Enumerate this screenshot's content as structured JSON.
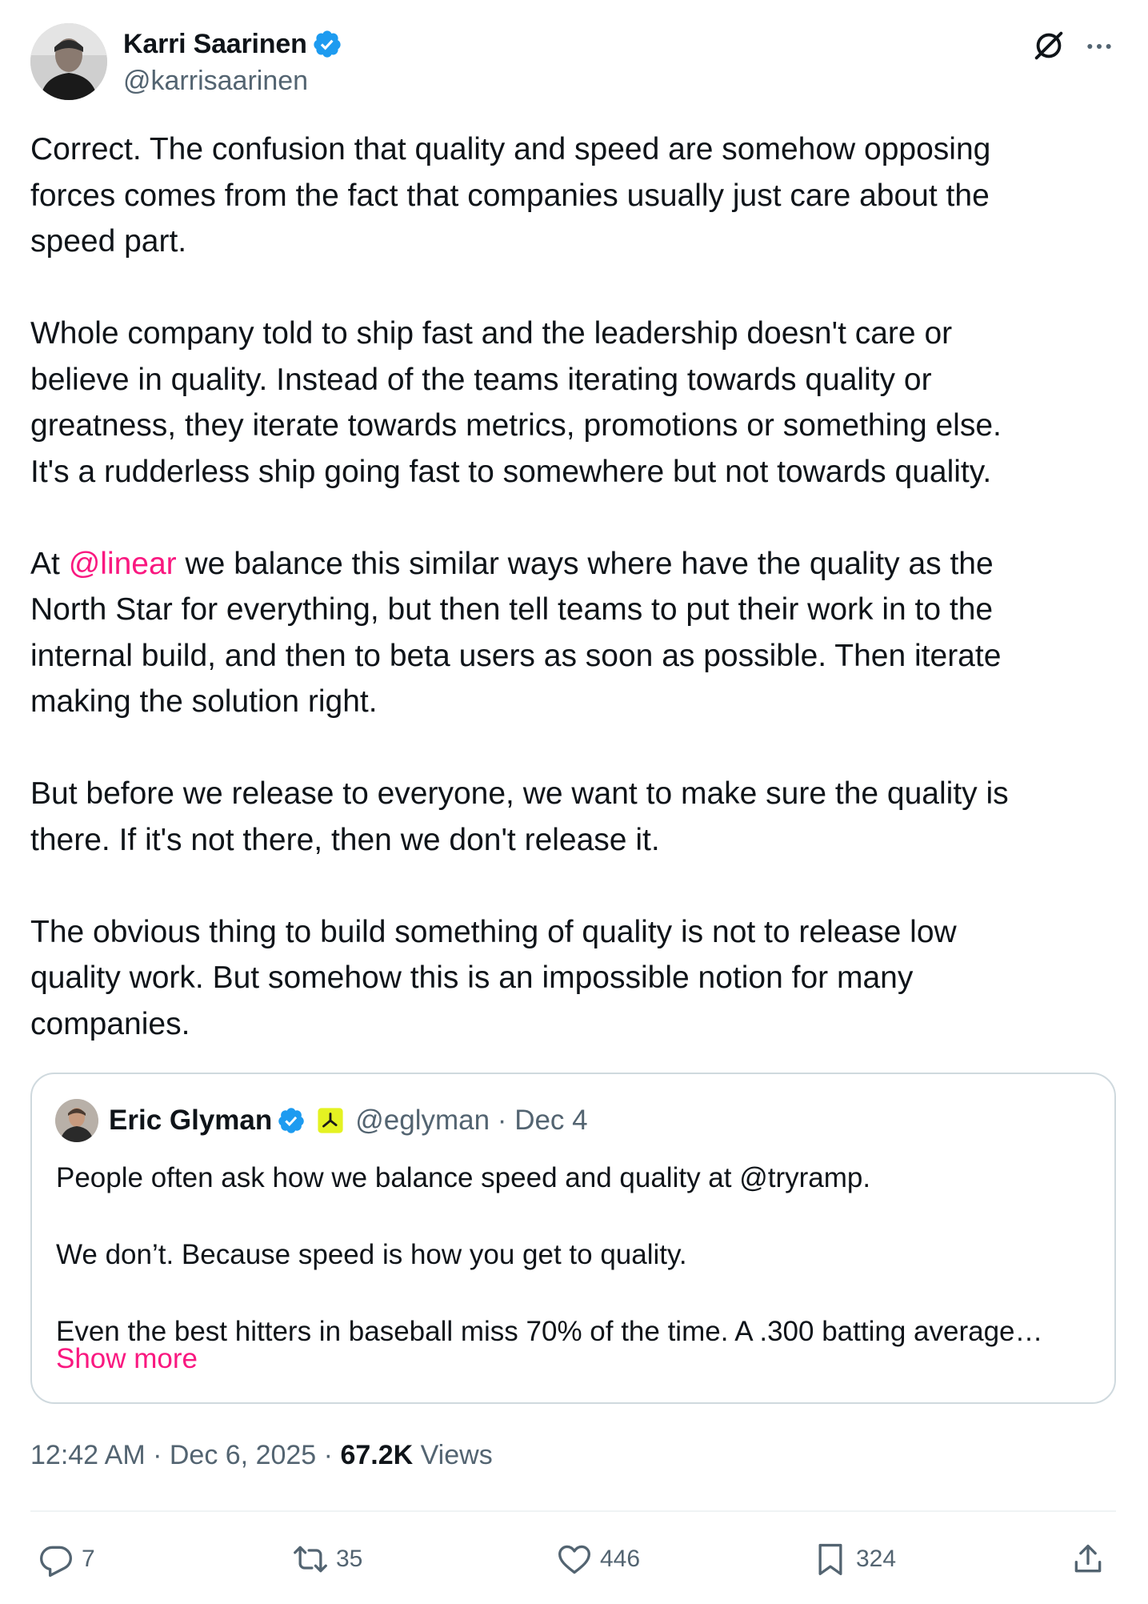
{
  "author": {
    "display_name": "Karri Saarinen",
    "handle": "@karrisaarinen",
    "avatar_icon": "profile-photo"
  },
  "tweet": {
    "text_part1": "Correct. The confusion that quality and speed are somehow opposing\nforces comes from the fact that companies usually just care about the\nspeed part.\n\nWhole company told to ship fast and the leadership doesn't care or\nbelieve in quality. Instead of the teams iterating towards quality or\ngreatness, they iterate towards metrics, promotions or something else.\nIt's a rudderless ship going fast to somewhere but not towards quality.\n\nAt ",
    "mention": "@linear",
    "text_part2": " we balance this similar ways where have the quality as the\nNorth Star for everything, but then tell teams to put their work in to the\ninternal build, and then to beta users as soon as possible. Then iterate\nmaking the solution right.\n\nBut before we release to everyone, we want to make sure the quality is\nthere. If it's not there, then we don't release it.\n\nThe obvious thing to build something of quality is not to release low\nquality work. But somehow this is an impossible notion for many\ncompanies."
  },
  "quote": {
    "display_name": "Eric Glyman",
    "handle_date": "@eglyman · Dec 4",
    "text": "People often ask how we balance speed and quality at @tryramp.\n\nWe don’t. Because speed is how you get to quality.\n\nEven the best hitters in baseball miss 70% of the time. A .300 batting average…",
    "show_more": "Show more"
  },
  "meta": {
    "timestamp": "12:42 AM · Dec 6, 2025 · ",
    "views_count": "67.2K",
    "views_label": " Views"
  },
  "actions": {
    "replies": "7",
    "reposts": "35",
    "likes": "446",
    "bookmarks": "324"
  },
  "colors": {
    "accent": "#f91880",
    "verified": "#1d9bf0",
    "secondary_text": "#536471",
    "border": "#cfd9de"
  }
}
